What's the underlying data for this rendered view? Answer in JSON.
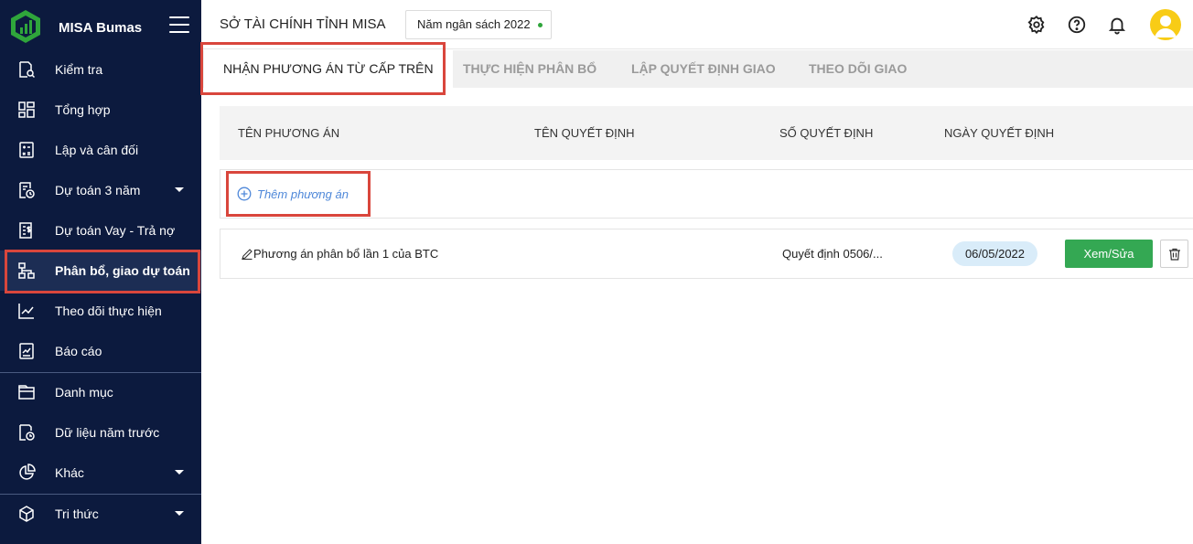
{
  "brand": {
    "name": "MISA Bumas"
  },
  "sidebar": {
    "items": [
      {
        "label": "Kiểm tra",
        "icon": "search-document-icon"
      },
      {
        "label": "Tổng hợp",
        "icon": "dashboard-grid-icon"
      },
      {
        "label": "Lập và cân đối",
        "icon": "calculator-icon"
      },
      {
        "label": "Dự toán 3 năm",
        "icon": "document-clock-icon",
        "has_submenu": true
      },
      {
        "label": "Dự toán Vay - Trả nợ",
        "icon": "money-document-icon"
      },
      {
        "label": "Phân bổ, giao dự toán",
        "icon": "hierarchy-icon",
        "active": true
      },
      {
        "label": "Theo dõi thực hiện",
        "icon": "line-chart-icon"
      },
      {
        "label": "Báo cáo",
        "icon": "report-icon"
      },
      {
        "label": "Danh mục",
        "icon": "folder-icon"
      },
      {
        "label": "Dữ liệu năm trước",
        "icon": "history-document-icon"
      },
      {
        "label": "Khác",
        "icon": "pie-chart-icon",
        "has_submenu": true
      },
      {
        "label": "Tri thức",
        "icon": "cube-icon",
        "has_submenu": true
      }
    ]
  },
  "header": {
    "org_name": "SỞ TÀI CHÍNH TỈNH MISA",
    "budget_year": "Năm ngân sách 2022",
    "icons": [
      "gear-icon",
      "help-icon",
      "bell-icon",
      "avatar"
    ]
  },
  "tabs": [
    {
      "label": "NHẬN PHƯƠNG ÁN TỪ CẤP TRÊN",
      "active": true
    },
    {
      "label": "THỰC HIỆN PHÂN BỔ"
    },
    {
      "label": "LẬP QUYẾT ĐỊNH GIAO"
    },
    {
      "label": "THEO DÕI GIAO"
    }
  ],
  "table": {
    "columns": [
      "TÊN PHƯƠNG ÁN",
      "TÊN QUYẾT ĐỊNH",
      "SỐ QUYẾT ĐỊNH",
      "NGÀY QUYẾT ĐỊNH"
    ],
    "add_label": "Thêm phương án",
    "rows": [
      {
        "plan_name": "Phương án phân bổ lần 1 của BTC",
        "decision_name": "",
        "decision_number": "Quyết định 0506/...",
        "decision_date": "06/05/2022",
        "view_label": "Xem/Sửa"
      }
    ]
  },
  "colors": {
    "sidebar_bg": "#0c1a3e",
    "highlight": "#d9463c",
    "primary_button": "#34a853",
    "link": "#4f88d9",
    "date_pill": "#d9ecf9"
  }
}
